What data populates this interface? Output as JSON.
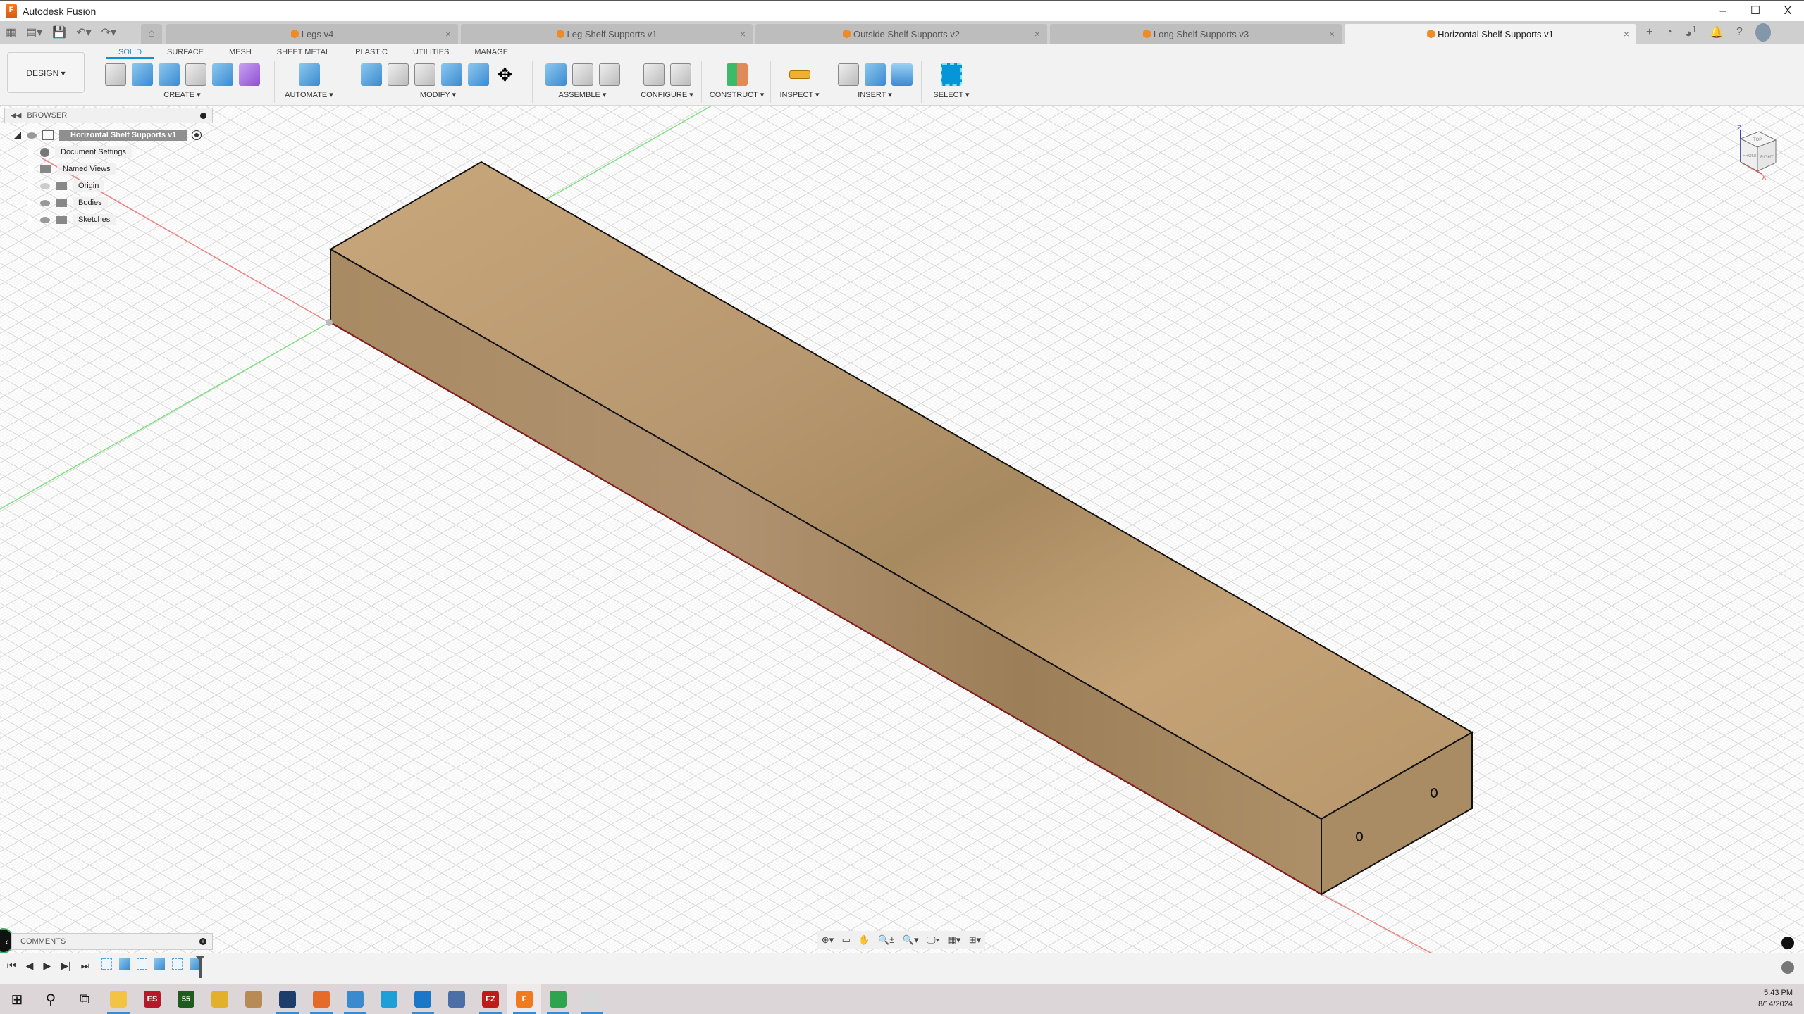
{
  "window": {
    "title": "Autodesk Fusion",
    "minimize": "–",
    "maximize": "☐",
    "close": "X"
  },
  "quick_access": {
    "grid_icon": "▦",
    "file_icon": "▤▾",
    "save_icon": "💾",
    "undo_icon": "↶▾",
    "redo_icon": "↷▾",
    "home_icon": "⌂"
  },
  "tabs": [
    {
      "label": "Legs v4",
      "active": false
    },
    {
      "label": "Leg Shelf Supports v1",
      "active": false
    },
    {
      "label": "Outside Shelf Supports v2",
      "active": false
    },
    {
      "label": "Long Shelf Supports v3",
      "active": false
    },
    {
      "label": "Horizontal Shelf Supports v1",
      "active": true
    }
  ],
  "tab_close": "×",
  "tab_actions": {
    "new_tab": "+",
    "job_status": "◔",
    "notifications_count": "1",
    "bell": "🔔",
    "help": "?"
  },
  "ribbon": {
    "workspace": "DESIGN ▾",
    "tabs": [
      "SOLID",
      "SURFACE",
      "MESH",
      "SHEET METAL",
      "PLASTIC",
      "UTILITIES",
      "MANAGE"
    ],
    "active_tab": "SOLID",
    "groups": [
      {
        "label": "CREATE ▾",
        "tools": [
          "create-sketch",
          "extrude",
          "revolve",
          "hole",
          "pattern",
          "create-form"
        ]
      },
      {
        "label": "AUTOMATE ▾",
        "tools": [
          "automate"
        ]
      },
      {
        "label": "MODIFY ▾",
        "tools": [
          "press-pull",
          "fillet",
          "shell",
          "combine",
          "split-body",
          "move-copy"
        ]
      },
      {
        "label": "ASSEMBLE ▾",
        "tools": [
          "new-component",
          "joint",
          "bill-of-materials"
        ]
      },
      {
        "label": "CONFIGURE ▾",
        "tools": [
          "configure",
          "configuration-table"
        ]
      },
      {
        "label": "CONSTRUCT ▾",
        "tools": [
          "offset-plane"
        ]
      },
      {
        "label": "INSPECT ▾",
        "tools": [
          "measure"
        ]
      },
      {
        "label": "INSERT ▾",
        "tools": [
          "insert-derive",
          "insert-mcmaster",
          "decal"
        ]
      },
      {
        "label": "SELECT ▾",
        "tools": [
          "select"
        ]
      }
    ]
  },
  "browser": {
    "title": "BROWSER",
    "root": "Horizontal Shelf Supports v1",
    "items": [
      {
        "label": "Document Settings",
        "icon": "gear",
        "visible": null
      },
      {
        "label": "Named Views",
        "icon": "folder",
        "visible": null
      },
      {
        "label": "Origin",
        "icon": "folder",
        "visible": false
      },
      {
        "label": "Bodies",
        "icon": "folder",
        "visible": true
      },
      {
        "label": "Sketches",
        "icon": "folder",
        "visible": true
      }
    ]
  },
  "viewcube": {
    "top": "TOP",
    "front": "FRONT",
    "right": "RIGHT",
    "z_axis": "Z",
    "x_axis": "X"
  },
  "model": {
    "material": "wood",
    "colors": {
      "top": "#c4a276",
      "front": "#a88a63",
      "end": "#a78962",
      "edge": "#1a1a1a"
    }
  },
  "comments": {
    "title": "COMMENTS",
    "add": "+"
  },
  "back_button": "‹",
  "nav_toolbar": [
    "⊕▾",
    "▭",
    "✋",
    "🔍±",
    "🔍▾",
    "🖵▾",
    "▦▾",
    "⊞▾"
  ],
  "timeline": {
    "controls": [
      "⏮",
      "◀",
      "▶",
      "▶|",
      "⏭"
    ],
    "features": [
      "sketch",
      "extrude",
      "sketch",
      "extrude",
      "sketch",
      "extrude"
    ]
  },
  "taskbar": {
    "apps": [
      {
        "name": "start",
        "glyph": "⊞",
        "color": "#111",
        "running": false
      },
      {
        "name": "search",
        "glyph": "⚲",
        "color": "#111",
        "running": false
      },
      {
        "name": "task-view",
        "glyph": "⧉",
        "color": "#111",
        "running": false
      },
      {
        "name": "file-explorer",
        "glyph": "",
        "color": "#f3c443",
        "running": true
      },
      {
        "name": "es-app",
        "glyph": "ES",
        "color": "#b31b2a",
        "running": false
      },
      {
        "name": "55-app",
        "glyph": "55",
        "color": "#1e5b1e",
        "running": false
      },
      {
        "name": "app-blue",
        "glyph": "",
        "color": "#e3b02c",
        "running": false
      },
      {
        "name": "game-app",
        "glyph": "",
        "color": "#b88a55",
        "running": false
      },
      {
        "name": "virtualbox",
        "glyph": "",
        "color": "#1d3d6b",
        "running": true
      },
      {
        "name": "firefox",
        "glyph": "",
        "color": "#e66a2a",
        "running": true
      },
      {
        "name": "chrome",
        "glyph": "",
        "color": "#3a8ad0",
        "running": true
      },
      {
        "name": "edge",
        "glyph": "",
        "color": "#1f9fd8",
        "running": false
      },
      {
        "name": "vscode",
        "glyph": "",
        "color": "#1b77c8",
        "running": true
      },
      {
        "name": "network-app",
        "glyph": "",
        "color": "#4c6fa8",
        "running": false
      },
      {
        "name": "filezilla",
        "glyph": "FZ",
        "color": "#bf1b1b",
        "running": true
      },
      {
        "name": "fusion",
        "glyph": "F",
        "color": "#f07a20",
        "running": true,
        "focused": true
      },
      {
        "name": "spreadsheet",
        "glyph": "",
        "color": "#2ea44f",
        "running": true
      },
      {
        "name": "inkscape-app",
        "glyph": "",
        "color": "#d8d8d8",
        "running": true
      }
    ],
    "time": "5:43 PM",
    "date": "8/14/2024"
  }
}
